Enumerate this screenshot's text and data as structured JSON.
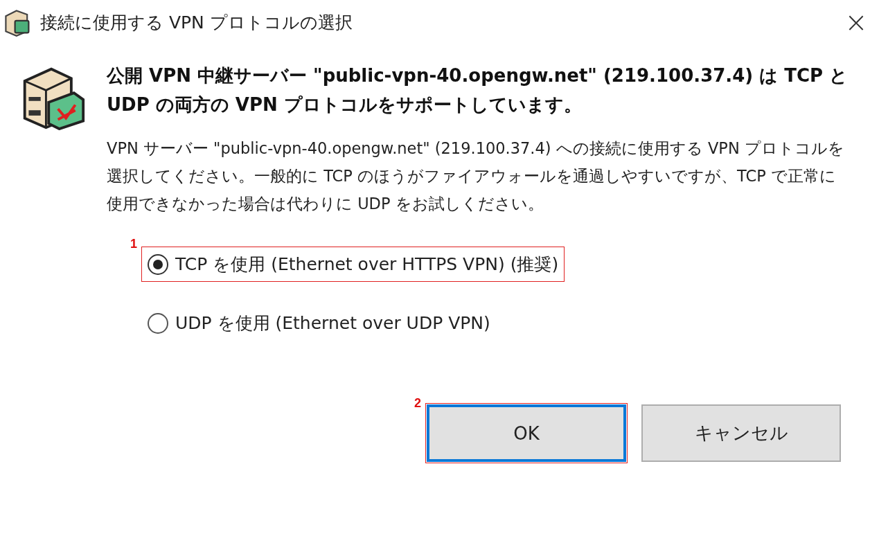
{
  "window": {
    "title": "接続に使用する VPN プロトコルの選択",
    "close": "×"
  },
  "heading": "公開 VPN 中継サーバー \"public-vpn-40.opengw.net\" (219.100.37.4) は TCP と UDP の両方の VPN プロトコルをサポートしています。",
  "description": "VPN サーバー \"public-vpn-40.opengw.net\" (219.100.37.4) への接続に使用する VPN プロトコルを選択してください。一般的に TCP のほうがファイアウォールを通過しやすいですが、TCP で正常に使用できなかった場合は代わりに UDP をお試しください。",
  "options": [
    {
      "label": "TCP を使用 (Ethernet over HTTPS VPN) (推奨)",
      "selected": true,
      "annotation": "1"
    },
    {
      "label": "UDP を使用 (Ethernet over UDP VPN)",
      "selected": false
    }
  ],
  "buttons": [
    {
      "label": "OK",
      "focused": true,
      "annotation": "2"
    },
    {
      "label": "キャンセル",
      "focused": false
    }
  ]
}
